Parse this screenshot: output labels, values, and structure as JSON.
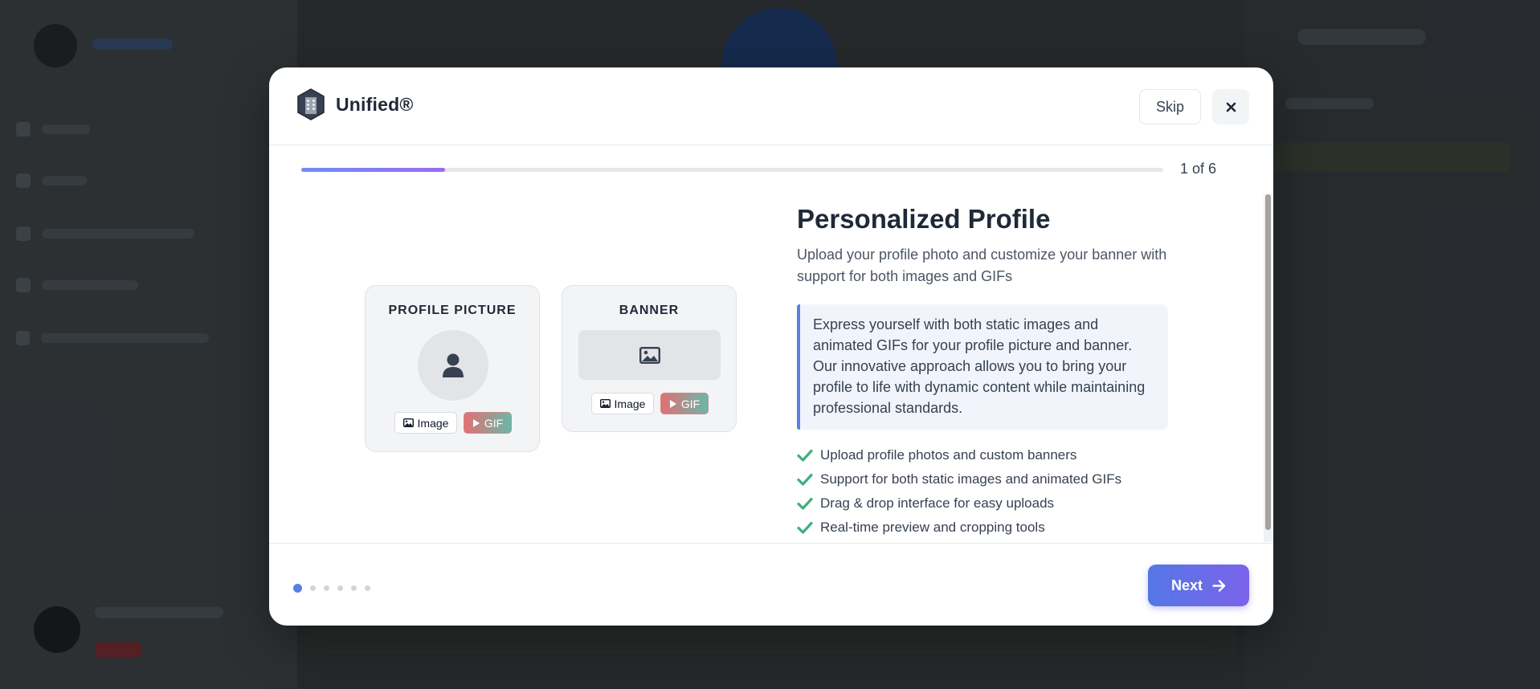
{
  "modal": {
    "brand": "Unified®",
    "skip_label": "Skip",
    "progress": {
      "text": "1 of 6",
      "fraction": 0.167
    },
    "profile_card": {
      "title": "PROFILE PICTURE",
      "image_chip": "Image",
      "gif_chip": "GIF"
    },
    "banner_card": {
      "title": "BANNER",
      "image_chip": "Image",
      "gif_chip": "GIF"
    },
    "feature": {
      "title": "Personalized Profile",
      "description": "Upload your profile photo and customize your banner with support for both images and GIFs",
      "callout": "Express yourself with both static images and animated GIFs for your profile picture and banner. Our innovative approach allows you to bring your profile to life with dynamic content while maintaining professional standards.",
      "bullets": [
        "Upload profile photos and custom banners",
        "Support for both static images and animated GIFs",
        "Drag & drop interface for easy uploads",
        "Real-time preview and cropping tools"
      ]
    },
    "pagination": {
      "total": 6,
      "current": 1
    },
    "next_label": "Next"
  },
  "colors": {
    "accent": "#5b7fe0",
    "check": "#3fae7f",
    "gif_gradient_start": "#e36f73",
    "gif_gradient_end": "#69b8a8"
  },
  "icons": {
    "brand": "building-icon",
    "close": "close-icon",
    "avatar": "user-icon",
    "banner": "image-icon",
    "chip_image": "image-icon",
    "chip_gif": "play-icon",
    "bullet": "check-icon",
    "next": "arrow-right-icon"
  }
}
